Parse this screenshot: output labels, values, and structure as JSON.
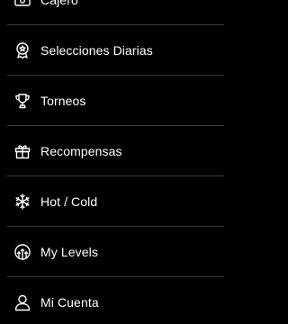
{
  "menu": {
    "items": [
      {
        "label": "Cajero",
        "icon": "cashier-icon"
      },
      {
        "label": "Selecciones Diarias",
        "icon": "award-badge-icon"
      },
      {
        "label": "Torneos",
        "icon": "trophy-icon"
      },
      {
        "label": "Recompensas",
        "icon": "gift-icon"
      },
      {
        "label": "Hot / Cold",
        "icon": "snowflake-icon"
      },
      {
        "label": "My Levels",
        "icon": "levels-icon"
      },
      {
        "label": "Mi Cuenta",
        "icon": "user-icon"
      }
    ]
  },
  "colors": {
    "background": "#000000",
    "text": "#ffffff",
    "divider": "#3a3a3a"
  }
}
